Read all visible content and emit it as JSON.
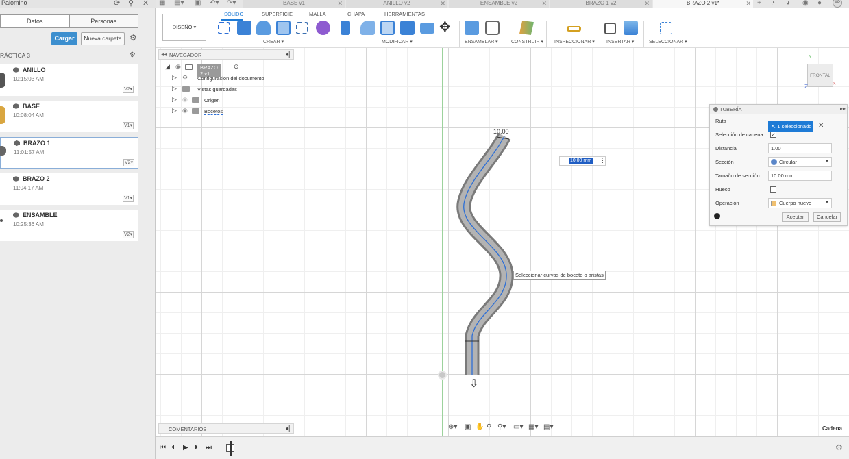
{
  "left_panel": {
    "user": "Palomino",
    "tabs": [
      "Datos",
      "Personas"
    ],
    "upload_label": "Cargar",
    "new_folder_label": "Nueva carpeta",
    "project": "RÁCTICA 3",
    "items": [
      {
        "name": "ANILLO",
        "time": "10:15:03 AM",
        "version": "V2"
      },
      {
        "name": "BASE",
        "time": "10:08:04 AM",
        "version": "V1"
      },
      {
        "name": "BRAZO 1",
        "time": "11:01:57 AM",
        "version": "V2"
      },
      {
        "name": "BRAZO 2",
        "time": "11:04:17 AM",
        "version": "V1"
      },
      {
        "name": "ENSAMBLE",
        "time": "10:25:36 AM",
        "version": "V2"
      }
    ]
  },
  "doc_tabs": [
    "BASE v1",
    "ANILLO v2",
    "ENSAMBLE v2",
    "BRAZO 1 v2",
    "BRAZO 2 v1*"
  ],
  "user_initials": "AP",
  "ribbon": {
    "workspace": "DISEÑO ▾",
    "tabs": [
      "SÓLIDO",
      "SUPERFICIE",
      "MALLA",
      "CHAPA",
      "HERRAMIENTAS"
    ],
    "groups": [
      "CREAR ▾",
      "MODIFICAR ▾",
      "ENSAMBLAR ▾",
      "CONSTRUIR ▾",
      "INSPECCIONAR ▾",
      "INSERTAR ▾",
      "SELECCIONAR ▾"
    ]
  },
  "navigator": {
    "title": "NAVEGADOR",
    "root": "BRAZO 2 v1",
    "items": [
      "Configuración del documento",
      "Vistas guardadas",
      "Origen",
      "Bocetos"
    ]
  },
  "viewcube": {
    "face": "FRONTAL",
    "z": "Z",
    "y": "Y",
    "x": "X"
  },
  "canvas": {
    "dimension_label": "10.00",
    "dimension_input": "10.00 mm",
    "tooltip": "Seleccionar curvas de boceto o aristas",
    "status_right": "Cadena",
    "comments_label": "COMENTARIOS"
  },
  "pipe_panel": {
    "title": "TUBERÍA",
    "fields": {
      "route_label": "Ruta",
      "route_value": "1 seleccionado",
      "chain_label": "Selección de cadena",
      "distance_label": "Distancia",
      "distance_value": "1.00",
      "section_label": "Sección",
      "section_value": "Circular",
      "section_size_label": "Tamaño de sección",
      "section_size_value": "10.00 mm",
      "hollow_label": "Hueco",
      "operation_label": "Operación",
      "operation_value": "Cuerpo nuevo"
    },
    "ok_label": "Aceptar",
    "cancel_label": "Cancelar"
  },
  "colors": {
    "accent": "#1e7bd6",
    "upload": "#3c8fcf",
    "pipe": "#8a8a8a",
    "sketch": "#2d6fd6"
  }
}
